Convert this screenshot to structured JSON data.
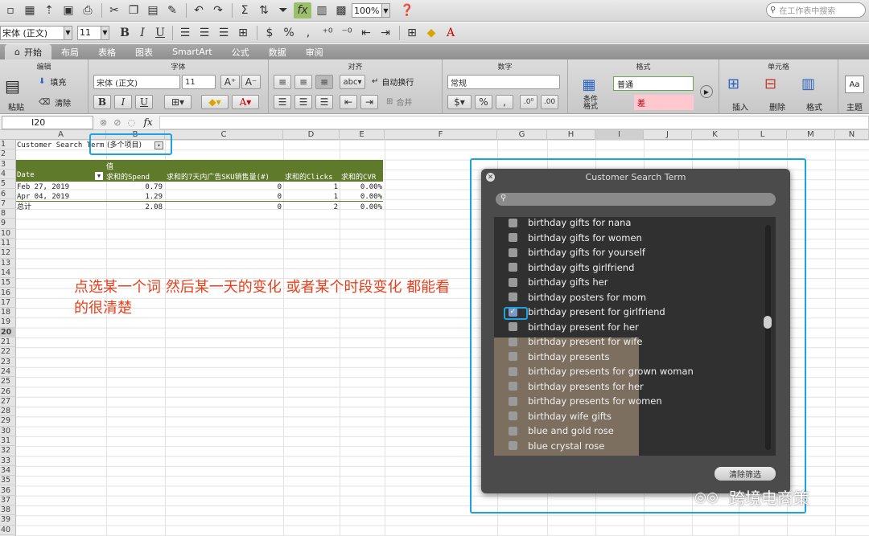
{
  "toolbar": {
    "zoom": "100%",
    "search_placeholder": "在工作表中搜索"
  },
  "format_bar": {
    "font": "宋体 (正文)",
    "size": "11",
    "bold": "B",
    "italic": "I",
    "underline": "U"
  },
  "tabs": [
    {
      "label": "开始",
      "active": true
    },
    {
      "label": "布局"
    },
    {
      "label": "表格"
    },
    {
      "label": "图表"
    },
    {
      "label": "SmartArt"
    },
    {
      "label": "公式"
    },
    {
      "label": "数据"
    },
    {
      "label": "审阅"
    }
  ],
  "ribbon": {
    "groups": {
      "edit": "编辑",
      "font": "字体",
      "align": "对齐",
      "number": "数字",
      "format": "格式",
      "cells": "单元格"
    },
    "paste": "粘贴",
    "fill": "填充",
    "clear": "清除",
    "font": "宋体 (正文)",
    "size": "11",
    "wrap": "自动换行",
    "merge": "合并",
    "number_format": "常规",
    "cond_format": "条件\n格式",
    "style_normal": "普通",
    "style_bad": "差",
    "insert": "插入",
    "delete": "删除",
    "format_btn": "格式",
    "theme": "主题"
  },
  "formula_bar": {
    "cell_ref": "I20",
    "fx": "fx"
  },
  "columns": [
    "A",
    "B",
    "C",
    "D",
    "E",
    "F",
    "G",
    "H",
    "I",
    "J",
    "K",
    "L",
    "M",
    "N"
  ],
  "rows": [
    "1",
    "2",
    "3",
    "4",
    "5",
    "6",
    "7",
    "8",
    "9",
    "10",
    "11",
    "12",
    "13",
    "14",
    "15",
    "16",
    "17",
    "18",
    "19",
    "20",
    "21",
    "22",
    "23",
    "24",
    "25",
    "26",
    "27",
    "28",
    "29",
    "30",
    "31",
    "32",
    "33",
    "34",
    "35",
    "36",
    "37",
    "38",
    "39",
    "40"
  ],
  "pivot": {
    "filter_label": "Customer Search Term",
    "filter_value": "(多个项目)",
    "values_label": "值",
    "headers": [
      "Date",
      "求和的Spend",
      "求和的7天内广告SKU销售量(#)",
      "求和的Clicks",
      "求和的CVR"
    ],
    "rows": [
      [
        "Feb 27, 2019",
        "0.79",
        "0",
        "1",
        "0.00%"
      ],
      [
        "Apr 04, 2019",
        "1.29",
        "0",
        "1",
        "0.00%"
      ]
    ],
    "total": [
      "总计",
      "2.08",
      "0",
      "2",
      "0.00%"
    ]
  },
  "annotation": "点选某一个词 然后某一天的变化 或者某个时段变化 都能看的很清楚",
  "filter_panel": {
    "title": "Customer Search Term",
    "items": [
      {
        "label": "birthday gifts for nana",
        "checked": false
      },
      {
        "label": "birthday gifts for women",
        "checked": false
      },
      {
        "label": "birthday gifts for yourself",
        "checked": false
      },
      {
        "label": "birthday gifts girlfriend",
        "checked": false
      },
      {
        "label": "birthday gifts her",
        "checked": false
      },
      {
        "label": "birthday posters for mom",
        "checked": false
      },
      {
        "label": "birthday present for girlfriend",
        "checked": true
      },
      {
        "label": "birthday present for her",
        "checked": false
      },
      {
        "label": "birthday present for wife",
        "checked": false
      },
      {
        "label": "birthday presents",
        "checked": false
      },
      {
        "label": "birthday presents for grown woman",
        "checked": false
      },
      {
        "label": "birthday presents for her",
        "checked": false
      },
      {
        "label": "birthday presents for women",
        "checked": false
      },
      {
        "label": "birthday wife gifts",
        "checked": false
      },
      {
        "label": "blue and gold rose",
        "checked": false
      },
      {
        "label": "blue crystal rose",
        "checked": false
      }
    ],
    "clear_button": "清除筛选"
  },
  "watermark": "跨境电商策",
  "colors": {
    "accent_highlight": "#1aa3e0",
    "pivot_header": "#5f7a2a",
    "annotation": "#e8401c"
  }
}
